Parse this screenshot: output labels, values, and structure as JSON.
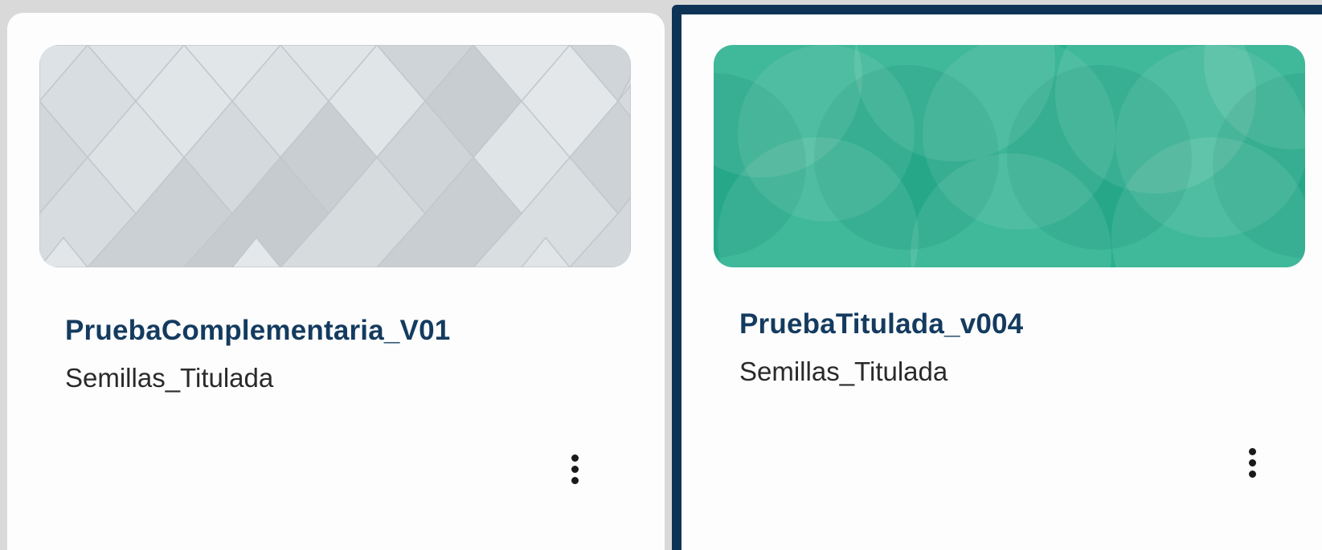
{
  "cards": [
    {
      "title": "PruebaComplementaria_V01",
      "subtitle": "Semillas_Titulada",
      "banner_pattern": "gray-diamonds",
      "banner_color": "#d3d8dc",
      "menu_icon": "more-vertical-icon",
      "selected": false
    },
    {
      "title": "PruebaTitulada_v004",
      "subtitle": "Semillas_Titulada",
      "banner_pattern": "green-circles",
      "banner_color": "#2bb08f",
      "menu_icon": "more-vertical-icon",
      "selected": true
    }
  ],
  "colors": {
    "background": "#d9d9d9",
    "card": "#fdfdfd",
    "title": "#143b5f",
    "selection_border": "#0d3457"
  }
}
